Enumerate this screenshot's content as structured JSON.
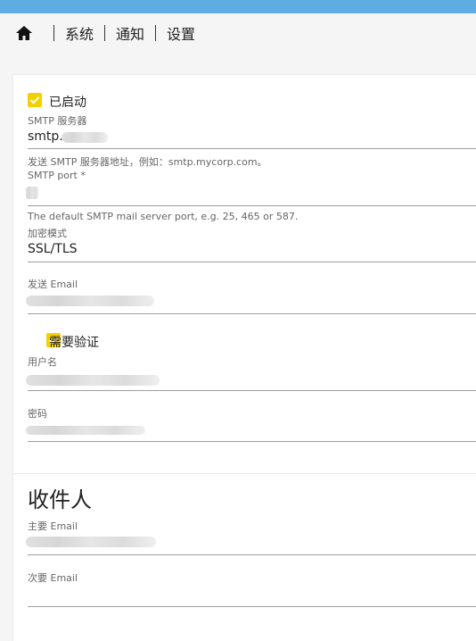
{
  "nav": {
    "home_icon": "home-icon",
    "items": [
      "系统",
      "通知",
      "设置"
    ]
  },
  "smtp": {
    "enabled_label": "已启动",
    "server_label": "SMTP 服务器",
    "server_value": "smtp.",
    "server_hint": "发送 SMTP 服务器地址，例如：smtp.mycorp.com。",
    "port_label": "SMTP port *",
    "port_hint": "The default SMTP mail server port, e.g. 25, 465 or 587.",
    "encryption_label": "加密模式",
    "encryption_value": "SSL/TLS",
    "from_label": "发送 Email",
    "auth_label": "需要验证",
    "username_label": "用户名",
    "password_label": "密码"
  },
  "recipients": {
    "title": "收件人",
    "primary_label": "主要 Email",
    "secondary_label": "次要 Email"
  },
  "colors": {
    "topbar": "#5dade2",
    "checkbox": "#f4d000"
  }
}
